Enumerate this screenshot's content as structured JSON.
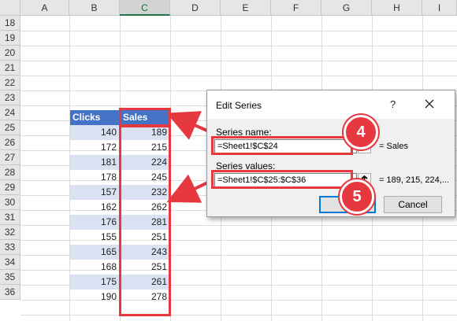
{
  "columns": [
    "A",
    "B",
    "C",
    "D",
    "E",
    "F",
    "G",
    "H",
    "I"
  ],
  "rows": [
    "18",
    "19",
    "20",
    "21",
    "22",
    "23",
    "24",
    "25",
    "26",
    "27",
    "28",
    "29",
    "30",
    "31",
    "32",
    "33",
    "34",
    "35",
    "36"
  ],
  "table": {
    "headers": [
      "Clicks",
      "Sales"
    ],
    "clicks": [
      "140",
      "172",
      "181",
      "178",
      "157",
      "162",
      "176",
      "155",
      "165",
      "168",
      "175",
      "190"
    ],
    "sales": [
      "189",
      "215",
      "224",
      "245",
      "232",
      "262",
      "281",
      "251",
      "243",
      "251",
      "261",
      "278"
    ]
  },
  "dialog": {
    "title": "Edit Series",
    "help": "?",
    "series_name_label": "Series name:",
    "series_name_value": "=Sheet1!$C$24",
    "series_name_result": "= Sales",
    "series_values_label": "Series values:",
    "series_values_value": "=Sheet1!$C$25:$C$36",
    "series_values_result": "= 189, 215, 224,...",
    "cancel_label": "Cancel"
  },
  "callouts": {
    "step4": "4",
    "step5": "5"
  },
  "colors": {
    "table_header": "#4472c4",
    "band": "#d9e1f2",
    "callout": "#e5383f",
    "selected_col": "#217346"
  }
}
